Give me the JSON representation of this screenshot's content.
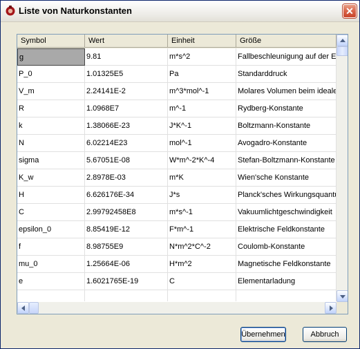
{
  "window": {
    "title": "Liste von Naturkonstanten",
    "close_label": "✕"
  },
  "table": {
    "columns": [
      "Symbol",
      "Wert",
      "Einheit",
      "Größe"
    ],
    "rows": [
      [
        "g",
        "9.81",
        "m*s^2",
        "Fallbeschleunigung auf der Er"
      ],
      [
        "P_0",
        "1.01325E5",
        "Pa",
        "Standarddruck"
      ],
      [
        "V_m",
        "2.24141E-2",
        "m^3*mol^-1",
        "Molares Volumen beim idealen"
      ],
      [
        "R",
        "1.0968E7",
        "m^-1",
        "Rydberg-Konstante"
      ],
      [
        "k",
        "1.38066E-23",
        "J*K^-1",
        "Boltzmann-Konstante"
      ],
      [
        "N",
        "6.02214E23",
        "mol^-1",
        "Avogadro-Konstante"
      ],
      [
        "sigma",
        "5.67051E-08",
        "W*m^-2*K^-4",
        "Stefan-Boltzmann-Konstante"
      ],
      [
        "K_w",
        "2.8978E-03",
        "m*K",
        "Wien'sche Konstante"
      ],
      [
        "H",
        "6.626176E-34",
        "J*s",
        "Planck'sches Wirkungsquantum"
      ],
      [
        "C",
        "2.99792458E8",
        "m*s^-1",
        "Vakuumlichtgeschwindigkeit"
      ],
      [
        "epsilon_0",
        "8.85419E-12",
        "F*m^-1",
        "Elektrische Feldkonstante"
      ],
      [
        "f",
        "8.98755E9",
        "N*m^2*C^-2",
        "Coulomb-Konstante"
      ],
      [
        "mu_0",
        "1.25664E-06",
        "H*m^2",
        "Magnetische Feldkonstante"
      ],
      [
        "e",
        "1.6021765E-19",
        "C",
        "Elementarladung"
      ],
      [
        "",
        "",
        "",
        ""
      ]
    ],
    "selected_row": 0
  },
  "buttons": {
    "apply": "Übernehmen",
    "cancel": "Abbruch"
  }
}
